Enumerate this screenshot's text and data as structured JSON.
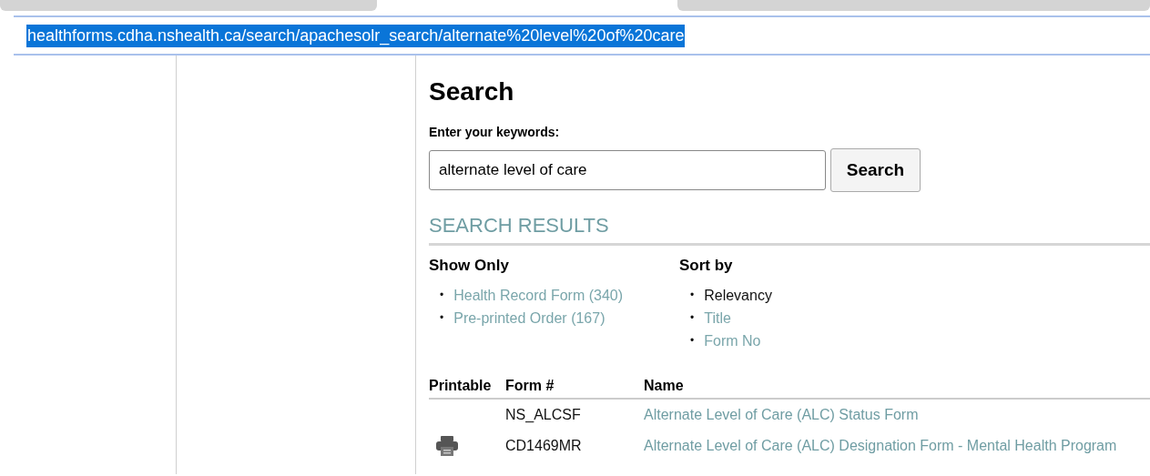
{
  "address_bar": {
    "url": "healthforms.cdha.nshealth.ca/search/apachesolr_search/alternate%20level%20of%20care",
    "selected": true
  },
  "search": {
    "title": "Search",
    "label": "Enter your keywords:",
    "value": "alternate level of care",
    "button": "Search"
  },
  "results_heading": "SEARCH RESULTS",
  "show_only": {
    "heading": "Show Only",
    "marker": "•",
    "items": [
      "Health Record Form (340)",
      "Pre-printed Order (167)"
    ]
  },
  "sort_by": {
    "heading": "Sort by",
    "marker": "•",
    "items": [
      {
        "label": "Relevancy",
        "selected": true
      },
      {
        "label": "Title",
        "selected": false
      },
      {
        "label": "Form No",
        "selected": false
      }
    ]
  },
  "table": {
    "columns": [
      "Printable",
      "Form #",
      "Name"
    ],
    "rows": [
      {
        "printable": false,
        "form_no": "NS_ALCSF",
        "name": "Alternate Level of Care (ALC) Status Form"
      },
      {
        "printable": true,
        "form_no": "CD1469MR",
        "name": "Alternate Level of Care (ALC) Designation Form - Mental Health Program"
      }
    ]
  }
}
